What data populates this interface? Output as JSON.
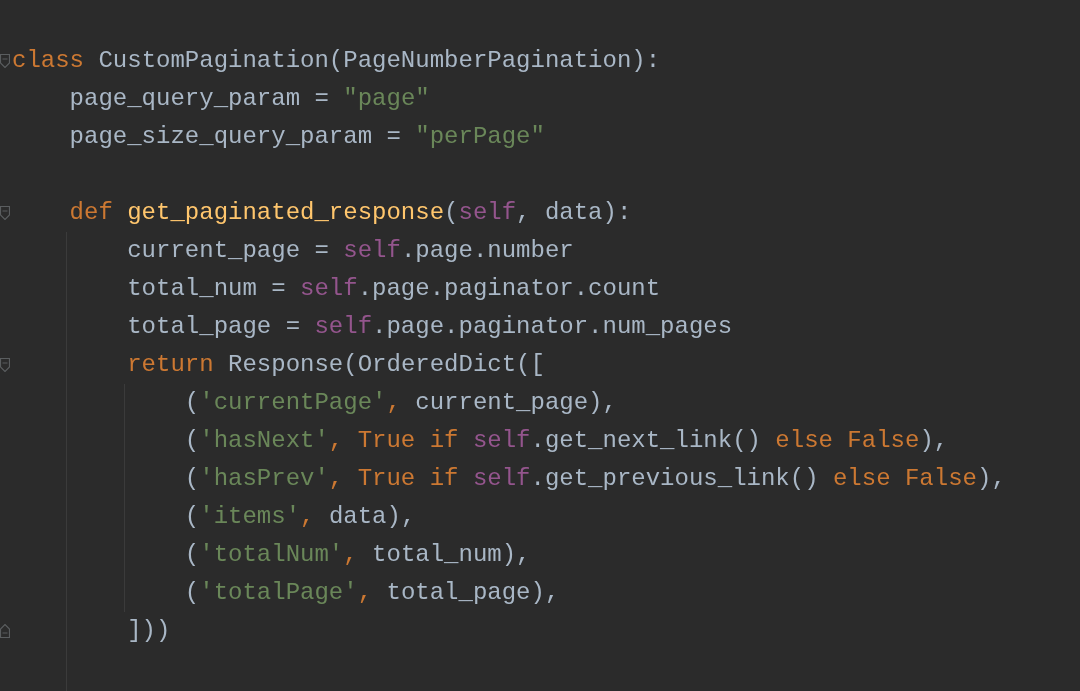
{
  "editor": {
    "lines": [
      {
        "kind": "code",
        "fold_start": true,
        "fold_end": false,
        "tokens": [
          {
            "t": "class ",
            "kind": "keyword"
          },
          {
            "t": "CustomPagination(PageNumberPagination):",
            "kind": "plain"
          }
        ]
      },
      {
        "kind": "code",
        "fold_start": false,
        "fold_end": false,
        "tokens": [
          {
            "t": "    page_query_param = ",
            "kind": "plain"
          },
          {
            "t": "\"page\"",
            "kind": "string"
          }
        ]
      },
      {
        "kind": "code",
        "fold_start": false,
        "fold_end": false,
        "tokens": [
          {
            "t": "    page_size_query_param = ",
            "kind": "plain"
          },
          {
            "t": "\"perPage\"",
            "kind": "string"
          }
        ]
      },
      {
        "kind": "blank"
      },
      {
        "kind": "code",
        "fold_start": true,
        "fold_end": false,
        "tokens": [
          {
            "t": "    def ",
            "kind": "keyword"
          },
          {
            "t": "get_paginated_response",
            "kind": "function"
          },
          {
            "t": "(",
            "kind": "plain"
          },
          {
            "t": "self",
            "kind": "self"
          },
          {
            "t": ", data):",
            "kind": "plain"
          }
        ]
      },
      {
        "kind": "code",
        "fold_start": false,
        "fold_end": false,
        "tokens": [
          {
            "t": "        current_page = ",
            "kind": "plain"
          },
          {
            "t": "self",
            "kind": "self"
          },
          {
            "t": ".page.number",
            "kind": "plain"
          }
        ]
      },
      {
        "kind": "code",
        "fold_start": false,
        "fold_end": false,
        "tokens": [
          {
            "t": "        total_num = ",
            "kind": "plain"
          },
          {
            "t": "self",
            "kind": "self"
          },
          {
            "t": ".page.paginator.count",
            "kind": "plain"
          }
        ]
      },
      {
        "kind": "code",
        "fold_start": false,
        "fold_end": false,
        "tokens": [
          {
            "t": "        total_page = ",
            "kind": "plain"
          },
          {
            "t": "self",
            "kind": "self"
          },
          {
            "t": ".page.paginator.num_pages",
            "kind": "plain"
          }
        ]
      },
      {
        "kind": "code",
        "fold_start": true,
        "fold_end": false,
        "tokens": [
          {
            "t": "        return ",
            "kind": "keyword"
          },
          {
            "t": "Response(OrderedDict([",
            "kind": "plain"
          }
        ]
      },
      {
        "kind": "code",
        "fold_start": false,
        "fold_end": false,
        "tokens": [
          {
            "t": "            (",
            "kind": "plain"
          },
          {
            "t": "'currentPage'",
            "kind": "string"
          },
          {
            "t": ", ",
            "kind": "keyword"
          },
          {
            "t": "current_page),",
            "kind": "plain"
          }
        ]
      },
      {
        "kind": "code",
        "fold_start": false,
        "fold_end": false,
        "tokens": [
          {
            "t": "            (",
            "kind": "plain"
          },
          {
            "t": "'hasNext'",
            "kind": "string"
          },
          {
            "t": ", True if ",
            "kind": "keyword"
          },
          {
            "t": "self",
            "kind": "self"
          },
          {
            "t": ".get_next_link() ",
            "kind": "plain"
          },
          {
            "t": "else False",
            "kind": "keyword"
          },
          {
            "t": "),",
            "kind": "plain"
          }
        ]
      },
      {
        "kind": "code",
        "fold_start": false,
        "fold_end": false,
        "tokens": [
          {
            "t": "            (",
            "kind": "plain"
          },
          {
            "t": "'hasPrev'",
            "kind": "string"
          },
          {
            "t": ", True if ",
            "kind": "keyword"
          },
          {
            "t": "self",
            "kind": "self"
          },
          {
            "t": ".get_previous_link() ",
            "kind": "plain"
          },
          {
            "t": "else False",
            "kind": "keyword"
          },
          {
            "t": "),",
            "kind": "plain"
          }
        ]
      },
      {
        "kind": "code",
        "fold_start": false,
        "fold_end": false,
        "tokens": [
          {
            "t": "            (",
            "kind": "plain"
          },
          {
            "t": "'items'",
            "kind": "string"
          },
          {
            "t": ", ",
            "kind": "keyword"
          },
          {
            "t": "data),",
            "kind": "plain"
          }
        ]
      },
      {
        "kind": "code",
        "fold_start": false,
        "fold_end": false,
        "tokens": [
          {
            "t": "            (",
            "kind": "plain"
          },
          {
            "t": "'totalNum'",
            "kind": "string"
          },
          {
            "t": ", ",
            "kind": "keyword"
          },
          {
            "t": "total_num),",
            "kind": "plain"
          }
        ]
      },
      {
        "kind": "code",
        "fold_start": false,
        "fold_end": false,
        "tokens": [
          {
            "t": "            (",
            "kind": "plain"
          },
          {
            "t": "'totalPage'",
            "kind": "string"
          },
          {
            "t": ", ",
            "kind": "keyword"
          },
          {
            "t": "total_page),",
            "kind": "plain"
          }
        ]
      },
      {
        "kind": "code",
        "fold_start": false,
        "fold_end": true,
        "tokens": [
          {
            "t": "        ]))",
            "kind": "plain"
          }
        ]
      },
      {
        "kind": "blank"
      }
    ]
  }
}
